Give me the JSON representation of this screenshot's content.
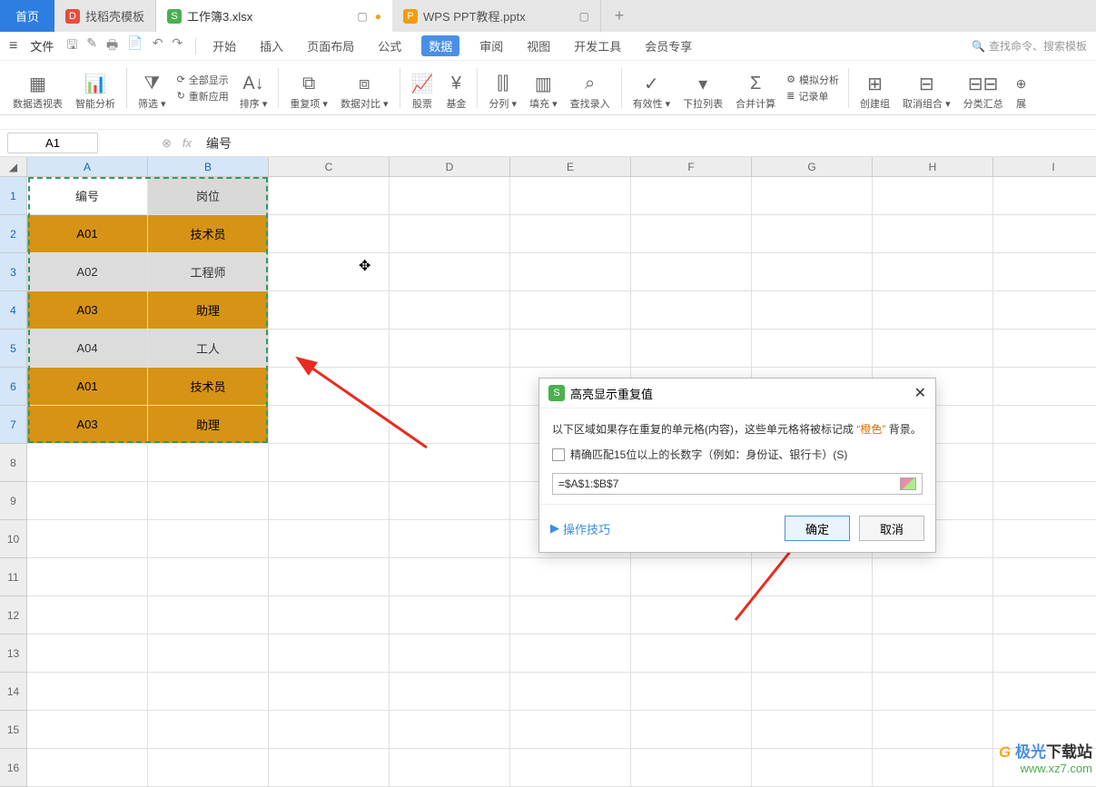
{
  "tabs": {
    "home": "首页",
    "template": "找稻壳模板",
    "workbook": "工作簿3.xlsx",
    "ppt": "WPS PPT教程.pptx"
  },
  "menu": {
    "file": "文件",
    "items": [
      "开始",
      "插入",
      "页面布局",
      "公式",
      "数据",
      "审阅",
      "视图",
      "开发工具",
      "会员专享"
    ],
    "search": "查找命令、搜索模板"
  },
  "ribbon": {
    "pivot": "数据透视表",
    "smart": "智能分析",
    "filter": "筛选",
    "showall": "全部显示",
    "reapply": "重新应用",
    "sort": "排序",
    "dup": "重复项",
    "compare": "数据对比",
    "stock": "股票",
    "fund": "基金",
    "split": "分列",
    "fill": "填充",
    "find": "查找录入",
    "valid": "有效性",
    "dropdown": "下拉列表",
    "consol": "合并计算",
    "simulate": "模拟分析",
    "record": "记录单",
    "groupnew": "创建组",
    "ungroup": "取消组合",
    "classify": "分类汇总",
    "expand": "展"
  },
  "formula": {
    "namebox": "A1",
    "text": "编号"
  },
  "columns": [
    "A",
    "B",
    "C",
    "D",
    "E",
    "F",
    "G",
    "H",
    "I"
  ],
  "table": {
    "headers": [
      "编号",
      "岗位"
    ],
    "rows": [
      {
        "a": "A01",
        "b": "技术员",
        "style": "orange"
      },
      {
        "a": "A02",
        "b": "工程师",
        "style": "gray"
      },
      {
        "a": "A03",
        "b": "助理",
        "style": "orange"
      },
      {
        "a": "A04",
        "b": "工人",
        "style": "gray"
      },
      {
        "a": "A01",
        "b": "技术员",
        "style": "orange"
      },
      {
        "a": "A03",
        "b": "助理",
        "style": "orange"
      }
    ]
  },
  "dialog": {
    "title": "高亮显示重复值",
    "desc_pre": "以下区域如果存在重复的单元格(内容)，这些单元格将被标记成",
    "desc_quote": "“橙色”",
    "desc_post": "背景。",
    "checkbox": "精确匹配15位以上的长数字（例如：身份证、银行卡）(S)",
    "range": "=$A$1:$B$7",
    "tips": "操作技巧",
    "ok": "确定",
    "cancel": "取消"
  },
  "watermark": {
    "brand_pre": "极光",
    "brand_post": "下载站",
    "url": "www.xz7.com"
  }
}
